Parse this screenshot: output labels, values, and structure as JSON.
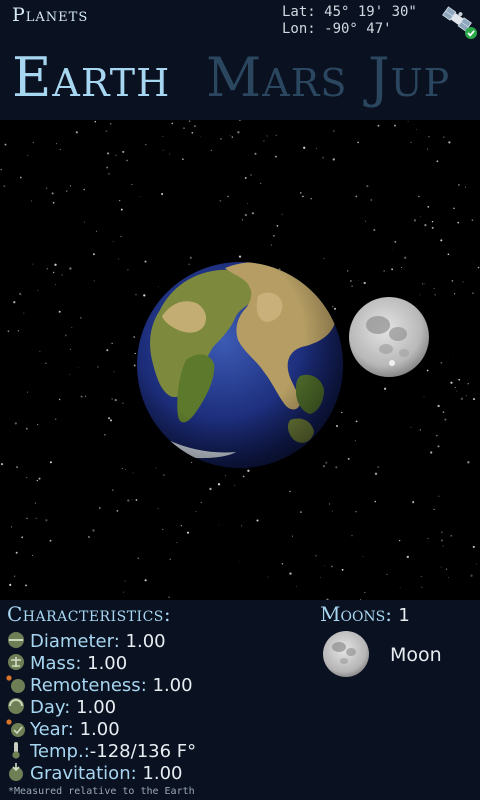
{
  "header": {
    "app_title": "Planets",
    "lat": "Lat: 45° 19' 30\"",
    "lon": "Lon: -90° 47'",
    "gps_icon": "satellite-icon",
    "gps_status_icon": "check-icon"
  },
  "tabs": [
    {
      "label": "Earth",
      "selected": true
    },
    {
      "label": "Mars",
      "selected": false
    },
    {
      "label": "Jup",
      "selected": false
    }
  ],
  "scene": {
    "planet": "earth-globe",
    "moon": "moon-sphere"
  },
  "characteristics": {
    "title": "Characteristics:",
    "rows": [
      {
        "icon": "diameter-icon",
        "label": "Diameter",
        "value": "1.00"
      },
      {
        "icon": "mass-icon",
        "label": "Mass",
        "value": "1.00"
      },
      {
        "icon": "remoteness-icon",
        "label": "Remoteness",
        "value": "1.00"
      },
      {
        "icon": "day-icon",
        "label": "Day",
        "value": "1.00"
      },
      {
        "icon": "year-icon",
        "label": "Year",
        "value": "1.00"
      },
      {
        "icon": "thermometer-icon",
        "label": "Temp.",
        "value": "-128/136 F°"
      },
      {
        "icon": "gravitation-icon",
        "label": "Gravitation",
        "value": "1.00"
      }
    ],
    "footnote": "*Measured relative to the Earth"
  },
  "moons": {
    "title": "Moons:",
    "count": "1",
    "items": [
      {
        "name": "Moon",
        "icon": "moon-icon"
      }
    ]
  },
  "colors": {
    "accent": "#a7d6f1",
    "inactive_tab": "#2b4760",
    "panel_bg": "#0a1120",
    "space_bg": "#000000"
  }
}
